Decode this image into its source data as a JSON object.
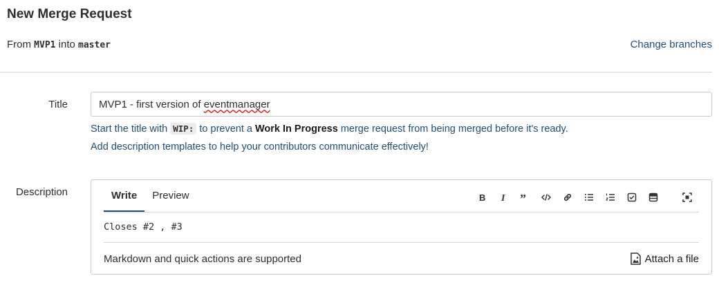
{
  "header": {
    "title": "New Merge Request",
    "from_label": "From",
    "source_branch": "MVP1",
    "into_label": "into",
    "target_branch": "master",
    "change_branches": "Change branches"
  },
  "title_field": {
    "label": "Title",
    "value_prefix": "MVP1 - first version of ",
    "value_misspelled": "eventmanager"
  },
  "hints": {
    "wip_pre": "Start the title with",
    "wip_code": "WIP:",
    "wip_mid": "to prevent a",
    "wip_strong": "Work In Progress",
    "wip_post": "merge request from being merged before it's ready.",
    "templates_link": "Add description templates",
    "templates_post": "to help your contributors communicate effectively!"
  },
  "description": {
    "label": "Description",
    "tabs": [
      {
        "label": "Write",
        "active": true
      },
      {
        "label": "Preview",
        "active": false
      }
    ],
    "toolbar_icons": [
      "bold-icon",
      "italic-icon",
      "quote-icon",
      "code-icon",
      "link-icon",
      "bullet-list-icon",
      "numbered-list-icon",
      "task-list-icon",
      "table-icon",
      "fullscreen-icon"
    ],
    "content": "Closes #2 , #3",
    "footer_text": "Markdown and quick actions are supported",
    "attach_label": "Attach a file"
  },
  "colors": {
    "accent": "#1f4e79",
    "border": "#c9c9c9"
  }
}
